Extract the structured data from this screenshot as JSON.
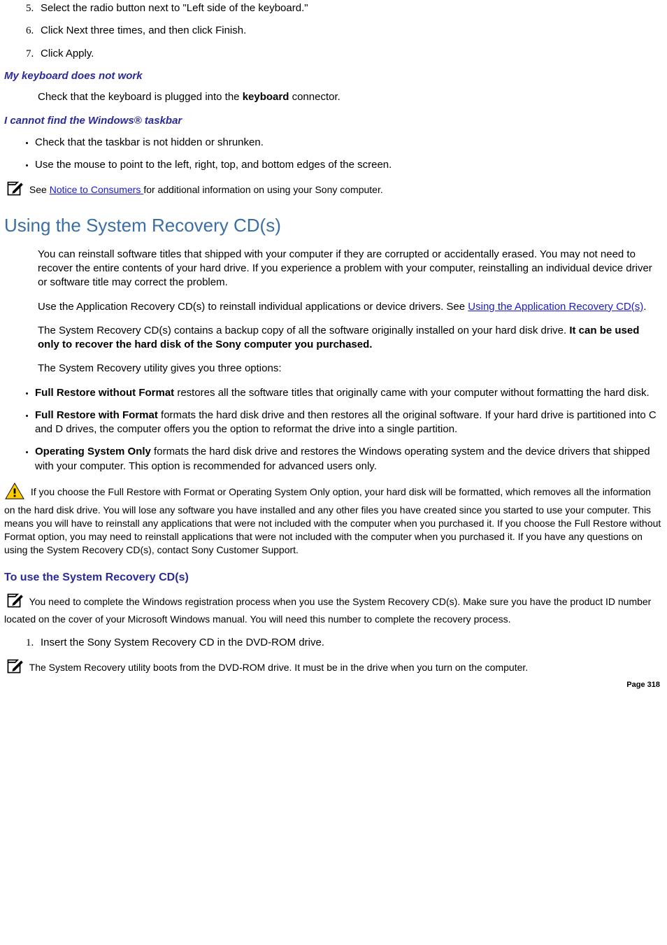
{
  "steps_top": [
    "Select the radio button next to \"Left side of the keyboard.\"",
    "Click Next three times, and then click Finish.",
    "Click Apply."
  ],
  "sec1": {
    "heading": "My keyboard does not work",
    "body_pre": "Check that the keyboard is plugged into the ",
    "bold": "keyboard",
    "body_post": " connector."
  },
  "sec2": {
    "heading": "I cannot find the Windows® taskbar",
    "bullets": [
      "Check that the taskbar is not hidden or shrunken.",
      "Use the mouse to point to the left, right, top, and bottom edges of the screen."
    ]
  },
  "note1": {
    "pre": "See ",
    "link": "Notice to Consumers ",
    "post": "for additional information on using your Sony computer."
  },
  "recovery": {
    "title": "Using the System Recovery CD(s)",
    "p1": "You can reinstall software titles that shipped with your computer if they are corrupted or accidentally erased. You may not need to recover the entire contents of your hard drive. If you experience a problem with your computer, reinstalling an individual device driver or software title may correct the problem.",
    "p2_pre": "Use the Application Recovery CD(s) to reinstall individual applications or device drivers. See ",
    "p2_link": "Using the Application Recovery CD(s)",
    "p2_post": ".",
    "p3_pre": "The System Recovery CD(s) contains a backup copy of all the software originally installed on your hard disk drive. ",
    "p3_bold": "It can be used only to recover the hard disk of the Sony computer you purchased.",
    "p4": "The System Recovery utility gives you three options:",
    "options": [
      {
        "bold": "Full Restore without Format",
        "rest": " restores all the software titles that originally came with your computer without formatting the hard disk."
      },
      {
        "bold": "Full Restore with Format",
        "rest": " formats the hard disk drive and then restores all the original software. If your hard drive is partitioned into C and D drives, the computer offers you the option to reformat the drive into a single partition."
      },
      {
        "bold": "Operating System Only",
        "rest": " formats the hard disk drive and restores the Windows operating system and the device drivers that shipped with your computer. This option is recommended for advanced users only."
      }
    ],
    "warning": "If you choose the Full Restore with Format or Operating System Only option, your hard disk will be formatted, which removes all the information on the hard disk drive. You will lose any software you have installed and any other files you have created since you started to use your computer. This means you will have to reinstall any applications that were not included with the computer when you purchased it. If you choose the Full Restore without Format option, you may need to reinstall applications that were not included with the computer when you purchased it. If you have any questions on using the System Recovery CD(s), contact Sony Customer Support."
  },
  "proc": {
    "heading": "To use the System Recovery CD(s)",
    "note": "You need to complete the Windows registration process when you use the System Recovery CD(s). Make sure you have the product ID number located on the cover of your Microsoft Windows manual. You will need this number to complete the recovery process.",
    "step1": "Insert the Sony System Recovery CD in the DVD-ROM drive.",
    "note2": "The System Recovery utility boots from the DVD-ROM drive. It must be in the drive when you turn on the computer."
  },
  "page_label": "Page 318"
}
